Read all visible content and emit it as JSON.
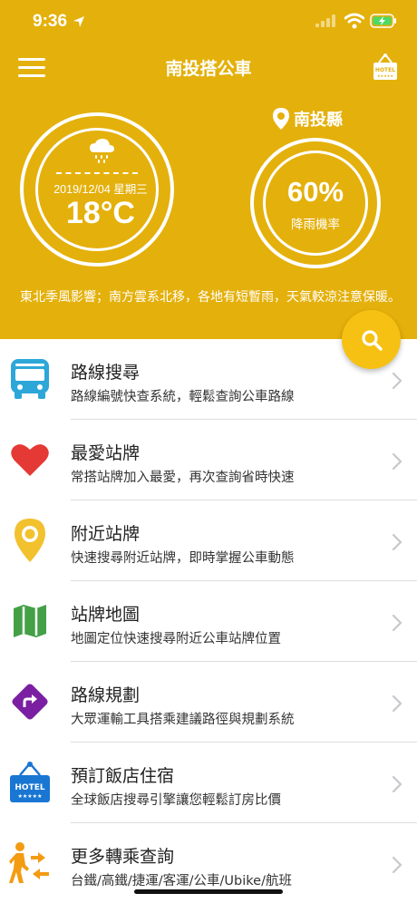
{
  "status": {
    "time": "9:36"
  },
  "nav": {
    "title": "南投搭公車",
    "hotel_badge": "HOTEL"
  },
  "weather": {
    "date": "2019/12/04 星期三",
    "temperature": "18°C",
    "county": "南投縣",
    "rain_probability": "60%",
    "rain_label": "降雨機率",
    "forecast": "東北季風影響；南方雲系北移，各地有短暫雨，天氣較涼注意保暖。"
  },
  "menu": [
    {
      "title": "路線搜尋",
      "desc": "路線編號快查系統，輕鬆查詢公車路線",
      "icon": "bus-icon"
    },
    {
      "title": "最愛站牌",
      "desc": "常搭站牌加入最愛，再次查詢省時快速",
      "icon": "heart-icon"
    },
    {
      "title": "附近站牌",
      "desc": "快速搜尋附近站牌，即時掌握公車動態",
      "icon": "map-pin-icon"
    },
    {
      "title": "站牌地圖",
      "desc": "地圖定位快速搜尋附近公車站牌位置",
      "icon": "map-icon"
    },
    {
      "title": "路線規劃",
      "desc": "大眾運輸工具搭乘建議路徑與規劃系統",
      "icon": "route-sign-icon"
    },
    {
      "title": "預訂飯店住宿",
      "desc": "全球飯店搜尋引擎讓您輕鬆訂房比價",
      "icon": "hotel-sign-icon",
      "badge": "HOTEL"
    },
    {
      "title": "更多轉乘查詢",
      "desc": "台鐵/高鐵/捷運/客運/公車/Ubike/航班",
      "icon": "transfer-walker-icon"
    }
  ],
  "colors": {
    "header": "#E4B00B",
    "fab": "#F6C112",
    "bus": "#2CA7D8",
    "heart": "#E53935",
    "pin": "#F2C12E",
    "map": "#43A047",
    "route": "#7B1FA2",
    "hotel": "#1976D2",
    "transfer": "#F39C12"
  }
}
